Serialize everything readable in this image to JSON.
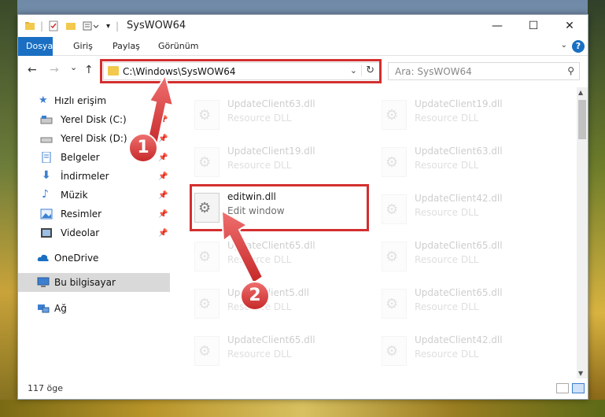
{
  "window": {
    "title": "SysWOW64",
    "controls": {
      "minimize": "—",
      "maximize": "☐",
      "close": "✕"
    }
  },
  "ribbon": {
    "tabs": [
      "Dosya",
      "Giriş",
      "Paylaş",
      "Görünüm"
    ],
    "help": "?"
  },
  "nav": {
    "back": "←",
    "forward": "→",
    "recent": "⌄",
    "up": "↑",
    "address": "C:\\Windows\\SysWOW64",
    "refresh": "↻",
    "search_placeholder": "Ara: SysWOW64"
  },
  "sidebar": {
    "items": [
      {
        "label": "Hızlı erişim"
      },
      {
        "label": "Yerel Disk (C:)"
      },
      {
        "label": "Yerel Disk (D:)"
      },
      {
        "label": "Belgeler"
      },
      {
        "label": "İndirmeler"
      },
      {
        "label": "Müzik"
      },
      {
        "label": "Resimler"
      },
      {
        "label": "Videolar"
      },
      {
        "label": "OneDrive"
      },
      {
        "label": "Bu bilgisayar"
      },
      {
        "label": "Ağ"
      }
    ]
  },
  "files": [
    {
      "name": "UpdateClient63.dll",
      "desc": "Resource DLL"
    },
    {
      "name": "UpdateClient19.dll",
      "desc": "Resource DLL"
    },
    {
      "name": "UpdateClient19.dll",
      "desc": "Resource DLL"
    },
    {
      "name": "UpdateClient63.dll",
      "desc": "Resource DLL"
    },
    {
      "name": "editwin.dll",
      "desc": "Edit window"
    },
    {
      "name": "UpdateClient42.dll",
      "desc": "Resource DLL"
    },
    {
      "name": "UpdateClient65.dll",
      "desc": "Resource DLL"
    },
    {
      "name": "UpdateClient65.dll",
      "desc": "Resource DLL"
    },
    {
      "name": "UpdateClient5.dll",
      "desc": "Resource DLL"
    },
    {
      "name": "UpdateClient65.dll",
      "desc": "Resource DLL"
    },
    {
      "name": "UpdateClient65.dll",
      "desc": "Resource DLL"
    },
    {
      "name": "UpdateClient42.dll",
      "desc": "Resource DLL"
    }
  ],
  "status": {
    "count": "117 öge"
  },
  "annotations": {
    "step1": "1",
    "step2": "2"
  },
  "colors": {
    "accent": "#1a6fc2",
    "highlight": "#d32f2f"
  }
}
